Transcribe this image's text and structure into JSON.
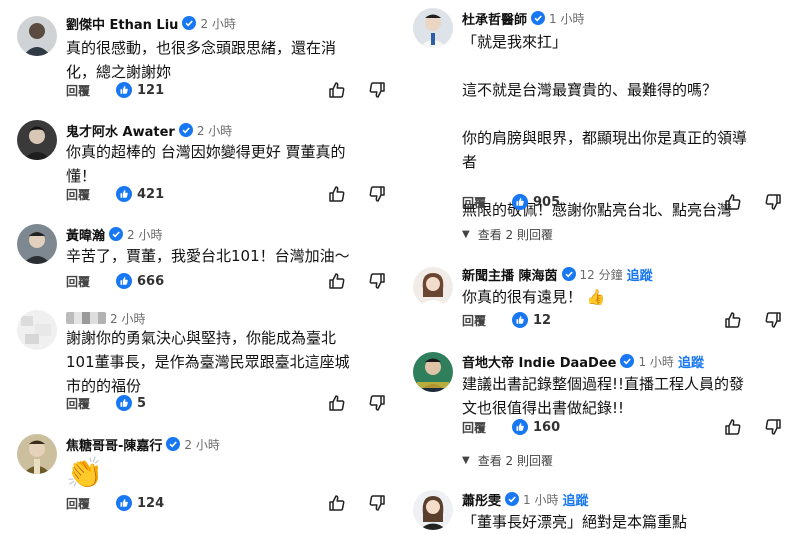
{
  "left": [
    {
      "name": "劉傑中 Ethan Liu",
      "verified": true,
      "time": "2 小時",
      "text": "真的很感動，也很多念頭跟思緒，還在消\n化，總之謝謝妳",
      "reply": "回覆",
      "likes": "121"
    },
    {
      "name": "鬼才阿水 Awater",
      "verified": true,
      "time": "2 小時",
      "text": "你真的超棒的 台灣因妳變得更好 賈董真的\n懂！",
      "reply": "回覆",
      "likes": "421"
    },
    {
      "name": "黃暐瀚",
      "verified": true,
      "time": "2 小時",
      "text": "辛苦了，賈董，我愛台北101！台灣加油～",
      "reply": "回覆",
      "likes": "666"
    },
    {
      "name": "",
      "verified": false,
      "time": "2 小時",
      "text": "謝謝你的勇氣決心與堅持，你能成為臺北\n101董事長，是作為臺灣民眾跟臺北這座城\n市的的福份",
      "reply": "回覆",
      "likes": "5"
    },
    {
      "name": "焦糖哥哥-陳嘉行",
      "verified": true,
      "time": "2 小時",
      "emoji": "👏",
      "reply": "回覆",
      "likes": "124"
    }
  ],
  "right": [
    {
      "name": "杜承哲醫師",
      "verified": true,
      "time": "1 小時",
      "text": "「就是我來扛」\n\n這不就是台灣最寶貴的、最難得的嗎？\n\n你的肩膀與眼界，都顯現出你是真正的領導\n者\n\n無限的敬佩！感謝你點亮台北、點亮台灣",
      "reply": "回覆",
      "likes": "905",
      "view_replies": "查看 2 則回覆"
    },
    {
      "name": "新聞主播 陳海茵",
      "verified": true,
      "time": "12 分鐘",
      "follow": "追蹤",
      "text": "你真的很有遠見！ 👍",
      "reply": "回覆",
      "likes": "12"
    },
    {
      "name": "音地大帝 Indie DaaDee",
      "verified": true,
      "time": "1 小時",
      "follow": "追蹤",
      "text": "建議出書記錄整個過程!!直播工程人員的發\n文也很值得出書做紀錄!!",
      "reply": "回覆",
      "likes": "160",
      "view_replies": "查看 2 則回覆"
    },
    {
      "name": "蕭彤雯",
      "verified": true,
      "time": "1 小時",
      "follow": "追蹤",
      "text": "「董事長好漂亮」絕對是本篇重點"
    }
  ],
  "colors": {
    "accent": "#1877f2",
    "text": "#111111",
    "muted": "#6b6b6b"
  },
  "icons": [
    "verified-badge-icon",
    "like-icon",
    "thumbs-up-icon",
    "thumbs-down-icon",
    "chevron-down-icon"
  ]
}
